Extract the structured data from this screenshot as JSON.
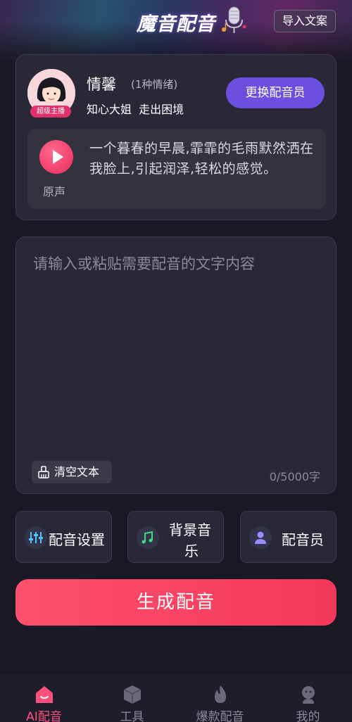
{
  "header": {
    "app_title": "魔音配音",
    "import_button": "导入文案"
  },
  "voice_card": {
    "avatar_badge": "超级主播",
    "name": "情馨",
    "emotions": "(1种情绪)",
    "tags": "知心大姐  走出困境",
    "change_button": "更换配音员",
    "sample_label": "原声",
    "sample_text": "一个暮春的早晨,霏霏的毛雨默然洒在我脸上,引起润泽,轻松的感觉。"
  },
  "editor": {
    "placeholder": "请输入或粘贴需要配音的文字内容",
    "clear_button": "清空文本",
    "char_count": "0/5000字"
  },
  "tools": {
    "settings": "配音设置",
    "bgm_line1": "背景音",
    "bgm_line2": "乐",
    "voice_actor": "配音员"
  },
  "generate_button": "生成配音",
  "nav": {
    "items": [
      {
        "label": "AI配音"
      },
      {
        "label": "工具"
      },
      {
        "label": "爆款配音"
      },
      {
        "label": "我的"
      }
    ]
  },
  "colors": {
    "accent": "#ff4f6e",
    "purple": "#6b50e0",
    "background": "#191825"
  }
}
